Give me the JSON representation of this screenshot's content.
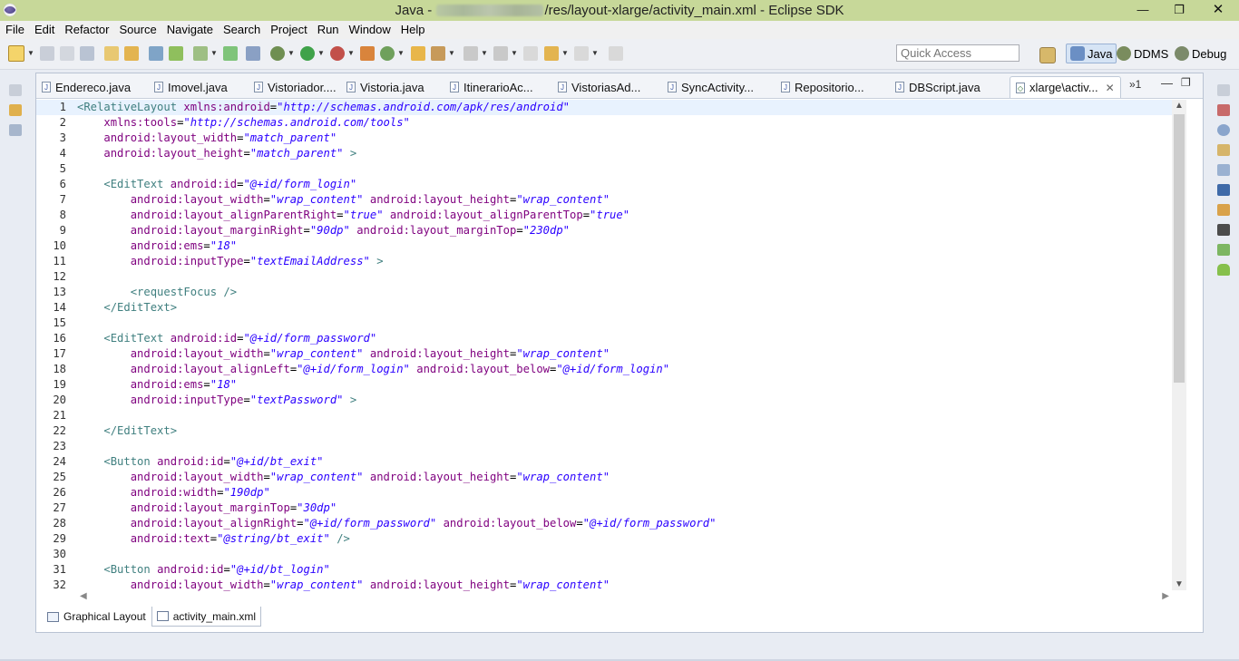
{
  "window": {
    "title_prefix": "Java - ",
    "title_suffix": "/res/layout-xlarge/activity_main.xml - Eclipse SDK",
    "controls": [
      "—",
      "❐",
      "✕"
    ]
  },
  "menu": [
    "File",
    "Edit",
    "Refactor",
    "Source",
    "Navigate",
    "Search",
    "Project",
    "Run",
    "Window",
    "Help"
  ],
  "quick_access": {
    "placeholder": "Quick Access"
  },
  "perspectives": [
    {
      "label": "Java",
      "active": true
    },
    {
      "label": "DDMS",
      "active": false
    },
    {
      "label": "Debug",
      "active": false
    }
  ],
  "editor_tabs": [
    {
      "label": "Endereco.java",
      "type": "J"
    },
    {
      "label": "Imovel.java",
      "type": "J"
    },
    {
      "label": "Vistoriador....",
      "type": "J"
    },
    {
      "label": "Vistoria.java",
      "type": "J"
    },
    {
      "label": "ItinerarioAc...",
      "type": "J"
    },
    {
      "label": "VistoriasAd...",
      "type": "J"
    },
    {
      "label": "SyncActivity...",
      "type": "J"
    },
    {
      "label": "Repositorio...",
      "type": "J"
    },
    {
      "label": "DBScript.java",
      "type": "J"
    },
    {
      "label": "xlarge\\activ...",
      "type": "xml",
      "active": true
    }
  ],
  "tab_overflow": "»1",
  "code_lines": [
    [
      [
        "tag",
        "<RelativeLayout "
      ],
      [
        "attr",
        "xmlns:android"
      ],
      [
        "pun",
        "="
      ],
      [
        "val",
        "\"http://schemas.android.com/apk/res/android\""
      ]
    ],
    [
      [
        "pun",
        "    "
      ],
      [
        "attr",
        "xmlns:tools"
      ],
      [
        "pun",
        "="
      ],
      [
        "val",
        "\"http://schemas.android.com/tools\""
      ]
    ],
    [
      [
        "pun",
        "    "
      ],
      [
        "attr",
        "android:layout_width"
      ],
      [
        "pun",
        "="
      ],
      [
        "val",
        "\"match_parent\""
      ]
    ],
    [
      [
        "pun",
        "    "
      ],
      [
        "attr",
        "android:layout_height"
      ],
      [
        "pun",
        "="
      ],
      [
        "val",
        "\"match_parent\""
      ],
      [
        "tag",
        " >"
      ]
    ],
    [],
    [
      [
        "pun",
        "    "
      ],
      [
        "tag",
        "<EditText "
      ],
      [
        "attr",
        "android:id"
      ],
      [
        "pun",
        "="
      ],
      [
        "val",
        "\"@+id/form_login\""
      ]
    ],
    [
      [
        "pun",
        "        "
      ],
      [
        "attr",
        "android:layout_width"
      ],
      [
        "pun",
        "="
      ],
      [
        "val",
        "\"wrap_content\""
      ],
      [
        "pun",
        " "
      ],
      [
        "attr",
        "android:layout_height"
      ],
      [
        "pun",
        "="
      ],
      [
        "val",
        "\"wrap_content\""
      ]
    ],
    [
      [
        "pun",
        "        "
      ],
      [
        "attr",
        "android:layout_alignParentRight"
      ],
      [
        "pun",
        "="
      ],
      [
        "val",
        "\"true\""
      ],
      [
        "pun",
        " "
      ],
      [
        "attr",
        "android:layout_alignParentTop"
      ],
      [
        "pun",
        "="
      ],
      [
        "val",
        "\"true\""
      ]
    ],
    [
      [
        "pun",
        "        "
      ],
      [
        "attr",
        "android:layout_marginRight"
      ],
      [
        "pun",
        "="
      ],
      [
        "val",
        "\"90dp\""
      ],
      [
        "pun",
        " "
      ],
      [
        "attr",
        "android:layout_marginTop"
      ],
      [
        "pun",
        "="
      ],
      [
        "val",
        "\"230dp\""
      ]
    ],
    [
      [
        "pun",
        "        "
      ],
      [
        "attr",
        "android:ems"
      ],
      [
        "pun",
        "="
      ],
      [
        "val",
        "\"18\""
      ]
    ],
    [
      [
        "pun",
        "        "
      ],
      [
        "attr",
        "android:inputType"
      ],
      [
        "pun",
        "="
      ],
      [
        "val",
        "\"textEmailAddress\""
      ],
      [
        "tag",
        " >"
      ]
    ],
    [],
    [
      [
        "pun",
        "        "
      ],
      [
        "tag",
        "<requestFocus />"
      ]
    ],
    [
      [
        "pun",
        "    "
      ],
      [
        "tag",
        "</EditText>"
      ]
    ],
    [],
    [
      [
        "pun",
        "    "
      ],
      [
        "tag",
        "<EditText "
      ],
      [
        "attr",
        "android:id"
      ],
      [
        "pun",
        "="
      ],
      [
        "val",
        "\"@+id/form_password\""
      ]
    ],
    [
      [
        "pun",
        "        "
      ],
      [
        "attr",
        "android:layout_width"
      ],
      [
        "pun",
        "="
      ],
      [
        "val",
        "\"wrap_content\""
      ],
      [
        "pun",
        " "
      ],
      [
        "attr",
        "android:layout_height"
      ],
      [
        "pun",
        "="
      ],
      [
        "val",
        "\"wrap_content\""
      ]
    ],
    [
      [
        "pun",
        "        "
      ],
      [
        "attr",
        "android:layout_alignLeft"
      ],
      [
        "pun",
        "="
      ],
      [
        "val",
        "\"@+id/form_login\""
      ],
      [
        "pun",
        " "
      ],
      [
        "attr",
        "android:layout_below"
      ],
      [
        "pun",
        "="
      ],
      [
        "val",
        "\"@+id/form_login\""
      ]
    ],
    [
      [
        "pun",
        "        "
      ],
      [
        "attr",
        "android:ems"
      ],
      [
        "pun",
        "="
      ],
      [
        "val",
        "\"18\""
      ]
    ],
    [
      [
        "pun",
        "        "
      ],
      [
        "attr",
        "android:inputType"
      ],
      [
        "pun",
        "="
      ],
      [
        "val",
        "\"textPassword\""
      ],
      [
        "tag",
        " >"
      ]
    ],
    [],
    [
      [
        "pun",
        "    "
      ],
      [
        "tag",
        "</EditText>"
      ]
    ],
    [],
    [
      [
        "pun",
        "    "
      ],
      [
        "tag",
        "<Button "
      ],
      [
        "attr",
        "android:id"
      ],
      [
        "pun",
        "="
      ],
      [
        "val",
        "\"@+id/bt_exit\""
      ]
    ],
    [
      [
        "pun",
        "        "
      ],
      [
        "attr",
        "android:layout_width"
      ],
      [
        "pun",
        "="
      ],
      [
        "val",
        "\"wrap_content\""
      ],
      [
        "pun",
        " "
      ],
      [
        "attr",
        "android:layout_height"
      ],
      [
        "pun",
        "="
      ],
      [
        "val",
        "\"wrap_content\""
      ]
    ],
    [
      [
        "pun",
        "        "
      ],
      [
        "attr",
        "android:width"
      ],
      [
        "pun",
        "="
      ],
      [
        "val",
        "\"190dp\""
      ]
    ],
    [
      [
        "pun",
        "        "
      ],
      [
        "attr",
        "android:layout_marginTop"
      ],
      [
        "pun",
        "="
      ],
      [
        "val",
        "\"30dp\""
      ]
    ],
    [
      [
        "pun",
        "        "
      ],
      [
        "attr",
        "android:layout_alignRight"
      ],
      [
        "pun",
        "="
      ],
      [
        "val",
        "\"@+id/form_password\""
      ],
      [
        "pun",
        " "
      ],
      [
        "attr",
        "android:layout_below"
      ],
      [
        "pun",
        "="
      ],
      [
        "val",
        "\"@+id/form_password\""
      ]
    ],
    [
      [
        "pun",
        "        "
      ],
      [
        "attr",
        "android:text"
      ],
      [
        "pun",
        "="
      ],
      [
        "val",
        "\"@string/bt_exit\""
      ],
      [
        "tag",
        " />"
      ]
    ],
    [],
    [
      [
        "pun",
        "    "
      ],
      [
        "tag",
        "<Button "
      ],
      [
        "attr",
        "android:id"
      ],
      [
        "pun",
        "="
      ],
      [
        "val",
        "\"@+id/bt_login\""
      ]
    ],
    [
      [
        "pun",
        "        "
      ],
      [
        "attr",
        "android:layout_width"
      ],
      [
        "pun",
        "="
      ],
      [
        "val",
        "\"wrap_content\""
      ],
      [
        "pun",
        " "
      ],
      [
        "attr",
        "android:layout_height"
      ],
      [
        "pun",
        "="
      ],
      [
        "val",
        "\"wrap_content\""
      ]
    ]
  ],
  "bottom_tabs": [
    {
      "label": "Graphical Layout",
      "active": false
    },
    {
      "label": "activity_main.xml",
      "active": true
    }
  ],
  "colors": {
    "titlebar": "#c7d899",
    "tag": "#3f7f7f",
    "attribute": "#7f007f",
    "value": "#2a00ff",
    "current_line": "#e8f2fe"
  }
}
